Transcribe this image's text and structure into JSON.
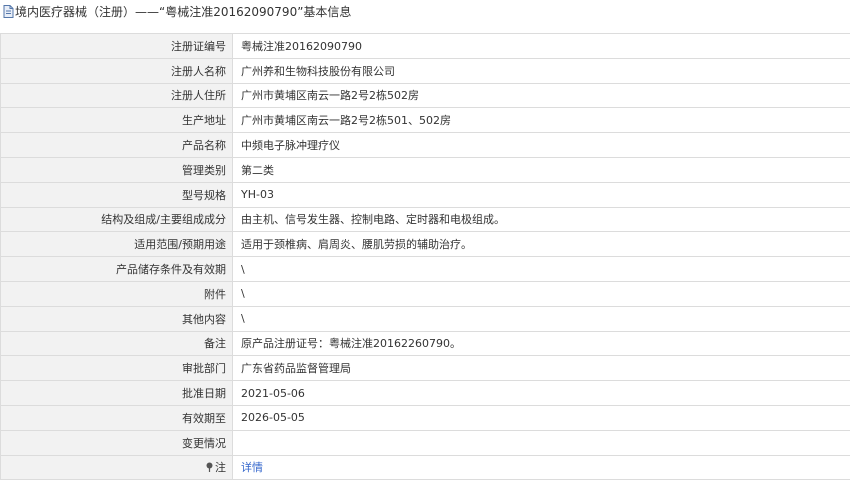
{
  "page": {
    "title": "境内医疗器械（注册）——“粤械注准20162090790”基本信息"
  },
  "rows": [
    {
      "label": "注册证编号",
      "value": "粤械注准20162090790"
    },
    {
      "label": "注册人名称",
      "value": "广州养和生物科技股份有限公司"
    },
    {
      "label": "注册人住所",
      "value": "广州市黄埔区南云一路2号2栋502房"
    },
    {
      "label": "生产地址",
      "value": "广州市黄埔区南云一路2号2栋501、502房"
    },
    {
      "label": "产品名称",
      "value": "中频电子脉冲理疗仪"
    },
    {
      "label": "管理类别",
      "value": "第二类"
    },
    {
      "label": "型号规格",
      "value": "YH-03"
    },
    {
      "label": "结构及组成/主要组成成分",
      "value": "由主机、信号发生器、控制电路、定时器和电极组成。"
    },
    {
      "label": "适用范围/预期用途",
      "value": "适用于颈椎病、肩周炎、腰肌劳损的辅助治疗。"
    },
    {
      "label": "产品储存条件及有效期",
      "value": "\\"
    },
    {
      "label": "附件",
      "value": "\\"
    },
    {
      "label": "其他内容",
      "value": "\\"
    },
    {
      "label": "备注",
      "value": "原产品注册证号：粤械注准20162260790。"
    },
    {
      "label": "审批部门",
      "value": "广东省药品监督管理局"
    },
    {
      "label": "批准日期",
      "value": "2021-05-06"
    },
    {
      "label": "有效期至",
      "value": "2026-05-05"
    },
    {
      "label": "变更情况",
      "value": ""
    }
  ],
  "note_row": {
    "label": "注",
    "link_text": "详情",
    "icon": "pin-icon"
  },
  "colors": {
    "label_bg": "#f2f2f2",
    "border": "#dcdcdc",
    "link": "#3366cc"
  }
}
